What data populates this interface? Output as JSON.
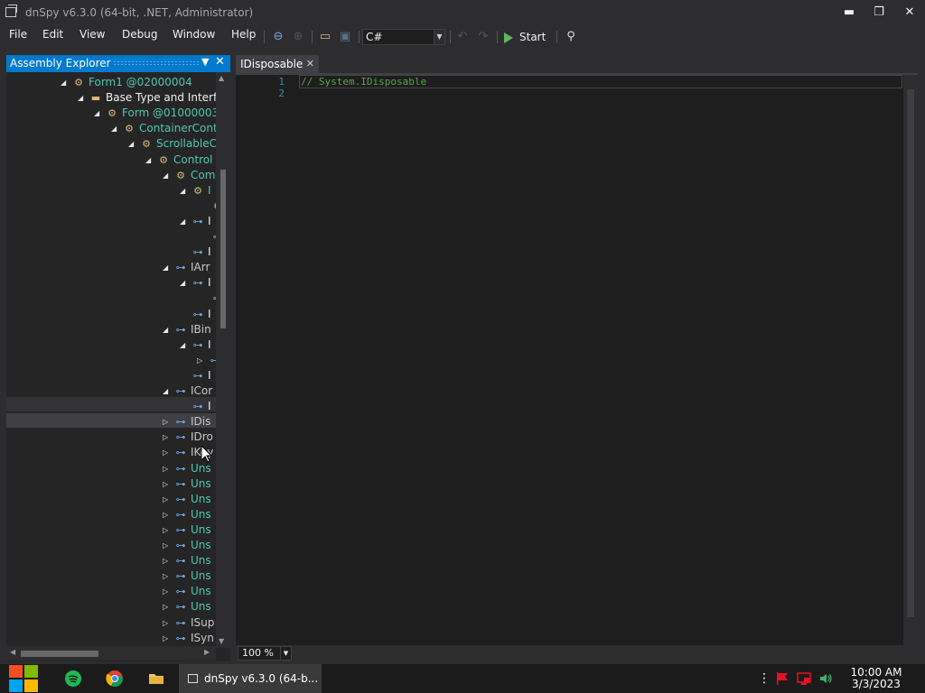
{
  "window": {
    "title": "dnSpy v6.3.0 (64-bit, .NET, Administrator)",
    "minimize": "▬",
    "restore": "❐",
    "close": "✕"
  },
  "menu": {
    "items": [
      "File",
      "Edit",
      "View",
      "Debug",
      "Window",
      "Help"
    ]
  },
  "toolbar": {
    "language": "C#",
    "start_label": "Start"
  },
  "explorer": {
    "title": "Assembly Explorer",
    "tree": [
      {
        "label": "Form1 @02000004",
        "style": "type",
        "icon": "class",
        "exp": "down"
      },
      {
        "label": "Base Type and Interf",
        "style": "plain",
        "icon": "folder",
        "exp": "down"
      },
      {
        "label": "Form @01000003",
        "style": "type",
        "icon": "class",
        "exp": "down"
      },
      {
        "label": "ContainerContr",
        "style": "type",
        "icon": "class",
        "exp": "down"
      },
      {
        "label": "ScrollableC",
        "style": "type",
        "icon": "class",
        "exp": "down"
      },
      {
        "label": "Control",
        "style": "type",
        "icon": "class",
        "exp": "down"
      },
      {
        "label": "Com",
        "style": "type",
        "icon": "class",
        "exp": "down"
      },
      {
        "label": "I",
        "style": "type",
        "icon": "class",
        "exp": "down"
      },
      {
        "label": "",
        "style": "type",
        "icon": "class",
        "exp": ""
      },
      {
        "label": "I",
        "style": "plain",
        "icon": "interface",
        "exp": "down"
      },
      {
        "label": "",
        "style": "plain",
        "icon": "interface",
        "exp": ""
      },
      {
        "label": "I",
        "style": "plain",
        "icon": "interface",
        "exp": ""
      },
      {
        "label": "IArr",
        "style": "dim",
        "icon": "interface",
        "exp": "down"
      },
      {
        "label": "I",
        "style": "plain",
        "icon": "interface",
        "exp": "down"
      },
      {
        "label": "",
        "style": "plain",
        "icon": "interface",
        "exp": ""
      },
      {
        "label": "I",
        "style": "plain",
        "icon": "interface",
        "exp": ""
      },
      {
        "label": "IBin",
        "style": "dim",
        "icon": "interface",
        "exp": "down"
      },
      {
        "label": "I",
        "style": "plain",
        "icon": "interface",
        "exp": "down"
      },
      {
        "label": "",
        "style": "plain",
        "icon": "interface",
        "exp": "right"
      },
      {
        "label": "I",
        "style": "plain",
        "icon": "interface",
        "exp": ""
      },
      {
        "label": "ICor",
        "style": "dim",
        "icon": "interface",
        "exp": "down"
      },
      {
        "label": "I",
        "style": "plain",
        "icon": "interface",
        "exp": ""
      },
      {
        "label": "IDis",
        "style": "dim",
        "icon": "interface",
        "exp": "right"
      },
      {
        "label": "IDro",
        "style": "dim",
        "icon": "interface",
        "exp": "right"
      },
      {
        "label": "IKey",
        "style": "dim",
        "icon": "interface",
        "exp": "right"
      },
      {
        "label": "Uns",
        "style": "type",
        "icon": "interface",
        "exp": "right"
      },
      {
        "label": "Uns",
        "style": "type",
        "icon": "interface",
        "exp": "right"
      },
      {
        "label": "Uns",
        "style": "type",
        "icon": "interface",
        "exp": "right"
      },
      {
        "label": "Uns",
        "style": "type",
        "icon": "interface",
        "exp": "right"
      },
      {
        "label": "Uns",
        "style": "type",
        "icon": "interface",
        "exp": "right"
      },
      {
        "label": "Uns",
        "style": "type",
        "icon": "interface",
        "exp": "right"
      },
      {
        "label": "Uns",
        "style": "type",
        "icon": "interface",
        "exp": "right"
      },
      {
        "label": "Uns",
        "style": "type",
        "icon": "interface",
        "exp": "right"
      },
      {
        "label": "Uns",
        "style": "type",
        "icon": "interface",
        "exp": "right"
      },
      {
        "label": "Uns",
        "style": "type",
        "icon": "interface",
        "exp": "right"
      },
      {
        "label": "ISup",
        "style": "dim",
        "icon": "interface",
        "exp": "right"
      },
      {
        "label": "ISyn",
        "style": "dim",
        "icon": "interface",
        "exp": "right"
      }
    ]
  },
  "editor": {
    "tab_label": "IDisposable",
    "tab_close": "✕",
    "line_numbers": [
      "1",
      "2"
    ],
    "code_line": "// System.IDisposable",
    "zoom": "100 %"
  },
  "taskbar": {
    "task_label": "dnSpy v6.3.0 (64-b...",
    "time": "10:00 AM",
    "date": "3/3/2023"
  },
  "colors": {
    "accent": "#007acc",
    "type_text": "#4ec9b0",
    "comment": "#57a64a",
    "line_number": "#2b91af"
  }
}
